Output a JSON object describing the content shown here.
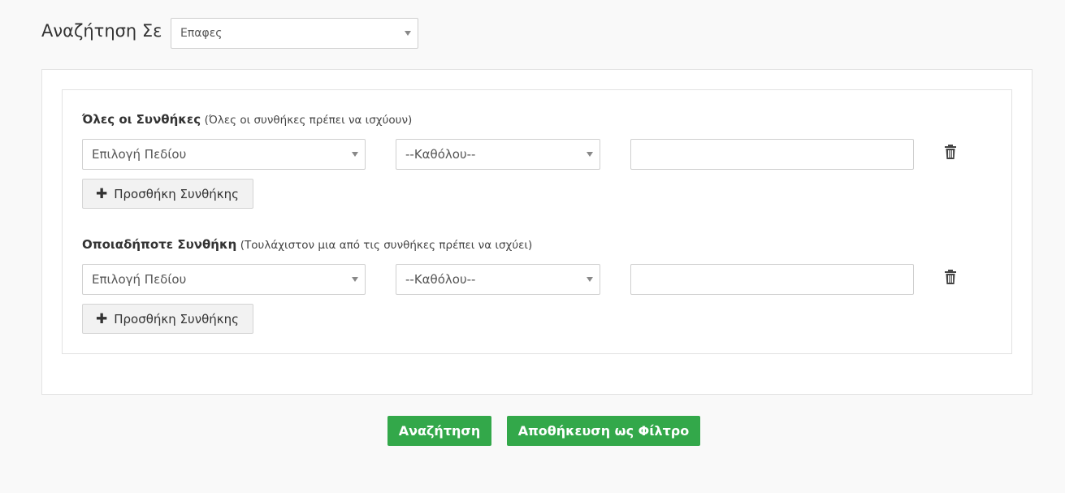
{
  "search_in": {
    "label": "Αναζήτηση Σε",
    "module_value": "Επαφες"
  },
  "groups": [
    {
      "title": "Όλες οι Συνθήκες",
      "hint": "(Όλες οι συνθήκες πρέπει να ισχύουν)",
      "field_value": "Επιλογή Πεδίου",
      "operator_value": "--Καθόλου--",
      "condition_value": "",
      "add_label": "Προσθήκη Συνθήκης"
    },
    {
      "title": "Οποιαδήποτε Συνθήκη",
      "hint": "(Τουλάχιστον μια από τις συνθήκες πρέπει να ισχύει)",
      "field_value": "Επιλογή Πεδίου",
      "operator_value": "--Καθόλου--",
      "condition_value": "",
      "add_label": "Προσθήκη Συνθήκης"
    }
  ],
  "actions": {
    "search_label": "Αναζήτηση",
    "save_filter_label": "Αποθήκευση ως Φίλτρο"
  },
  "icons": {
    "add": "plus-icon",
    "delete": "trash-icon",
    "dropdown": "caret-down-icon"
  },
  "colors": {
    "primary": "#33a84a",
    "background": "#f9f9f9"
  }
}
